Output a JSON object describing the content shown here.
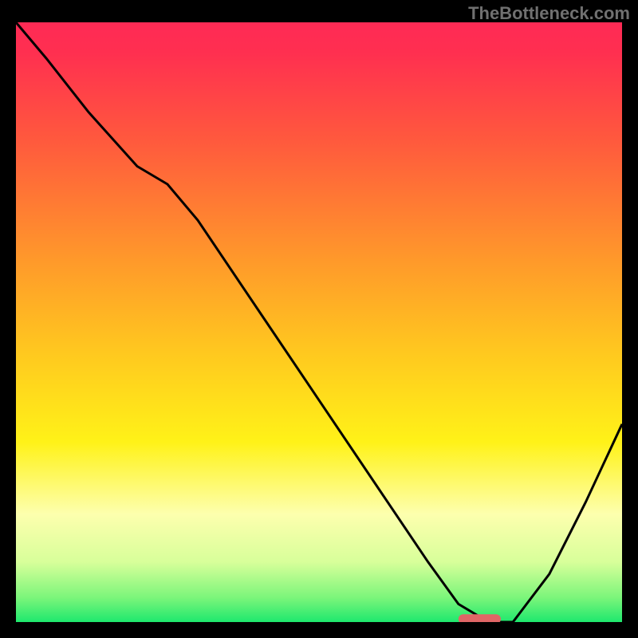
{
  "watermark": "TheBottleneck.com",
  "chart_data": {
    "type": "line",
    "title": "",
    "xlabel": "",
    "ylabel": "",
    "xlim": [
      0,
      100
    ],
    "ylim": [
      0,
      100
    ],
    "x": [
      0,
      5,
      12,
      20,
      25,
      30,
      40,
      50,
      60,
      68,
      73,
      78,
      82,
      88,
      94,
      100
    ],
    "values": [
      100,
      94,
      85,
      76,
      73,
      67,
      52,
      37,
      22,
      10,
      3,
      0,
      0,
      8,
      20,
      33
    ],
    "marker": {
      "x_start": 73,
      "x_end": 80,
      "y": 0.5
    },
    "gradient_stops": [
      {
        "pos": 0.0,
        "color": "#ff2a55"
      },
      {
        "pos": 0.05,
        "color": "#ff2f50"
      },
      {
        "pos": 0.2,
        "color": "#ff5a3d"
      },
      {
        "pos": 0.4,
        "color": "#ff9a2a"
      },
      {
        "pos": 0.55,
        "color": "#ffc81f"
      },
      {
        "pos": 0.7,
        "color": "#fff218"
      },
      {
        "pos": 0.82,
        "color": "#fdffae"
      },
      {
        "pos": 0.9,
        "color": "#d8ff9a"
      },
      {
        "pos": 0.96,
        "color": "#7af57a"
      },
      {
        "pos": 1.0,
        "color": "#1ee86e"
      }
    ]
  }
}
